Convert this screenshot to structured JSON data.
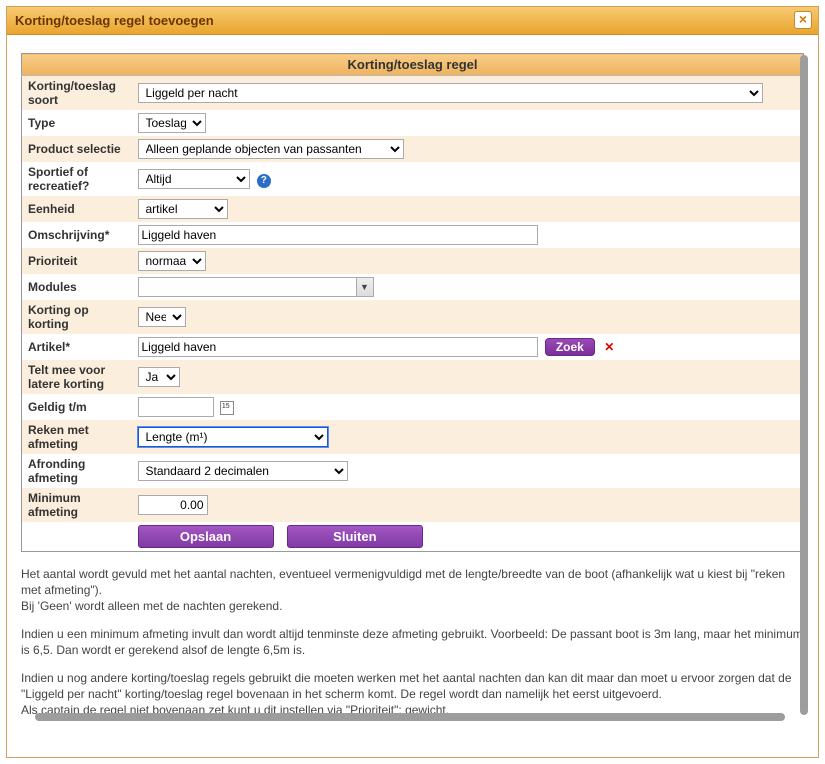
{
  "modal": {
    "title": "Korting/toeslag regel toevoegen",
    "close_label": "×"
  },
  "section_header": "Korting/toeslag regel",
  "rows": {
    "soort": {
      "label": "Korting/toeslag soort",
      "value": "Liggeld per nacht"
    },
    "type": {
      "label": "Type",
      "value": "Toeslag"
    },
    "product": {
      "label": "Product selectie",
      "value": "Alleen geplande objecten van passanten"
    },
    "sportief": {
      "label": "Sportief of recreatief?",
      "value": "Altijd"
    },
    "eenheid": {
      "label": "Eenheid",
      "value": "artikel"
    },
    "omschrijving": {
      "label": "Omschrijving*",
      "value": "Liggeld haven"
    },
    "prioriteit": {
      "label": "Prioriteit",
      "value": "normaal"
    },
    "modules": {
      "label": "Modules",
      "value": ""
    },
    "korting_op": {
      "label": "Korting op korting",
      "value": "Nee"
    },
    "artikel": {
      "label": "Artikel*",
      "value": "Liggeld haven",
      "zoek": "Zoek"
    },
    "telt_mee": {
      "label": "Telt mee voor latere korting",
      "value": "Ja"
    },
    "geldig": {
      "label": "Geldig t/m",
      "value": ""
    },
    "reken": {
      "label": "Reken met afmeting",
      "value": "Lengte (m¹)"
    },
    "afronding": {
      "label": "Afronding afmeting",
      "value": "Standaard 2 decimalen"
    },
    "minimum": {
      "label": "Minimum afmeting",
      "value": "0.00"
    }
  },
  "buttons": {
    "save": "Opslaan",
    "close": "Sluiten"
  },
  "help": {
    "p1": "Het aantal wordt gevuld met het aantal nachten, eventueel vermenigvuldigd met de lengte/breedte van de boot (afhankelijk wat u kiest bij \"reken met afmeting\").",
    "p1b": "Bij 'Geen' wordt alleen met de nachten gerekend.",
    "p2": "Indien u een minimum afmeting invult dan wordt altijd tenminste deze afmeting gebruikt. Voorbeeld: De passant boot is 3m lang, maar het minimum is 6,5. Dan wordt er gerekend alsof de lengte 6,5m is.",
    "p3": "Indien u nog andere korting/toeslag regels gebruikt die moeten werken met het aantal nachten dan kan dit maar dan moet u ervoor zorgen dat de \"Liggeld per nacht\" korting/toeslag regel bovenaan in het scherm komt. De regel wordt dan namelijk het eerst uitgevoerd.",
    "p3b": "Als captain de regel niet bovenaan zet kunt u dit instellen via \"Prioriteit\": gewicht."
  },
  "icons": {
    "help": "?",
    "delete": "✕"
  }
}
